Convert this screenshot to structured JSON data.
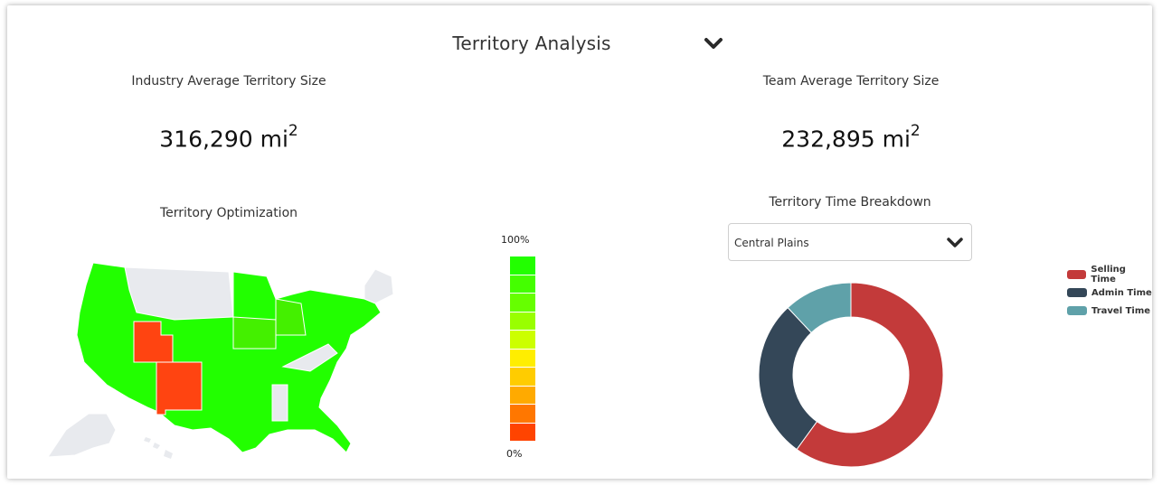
{
  "header": {
    "title": "Territory Analysis",
    "collapse_icon": "chevron-down-icon"
  },
  "industry": {
    "label": "Industry Average Territory Size",
    "value": "316,290 mi",
    "unit_exponent": "2"
  },
  "team": {
    "label": "Team Average Territory Size",
    "value": "232,895 mi",
    "unit_exponent": "2"
  },
  "optimization": {
    "title": "Territory Optimization",
    "scale_max_label": "100%",
    "scale_min_label": "0%",
    "scale_colors": [
      "#22ff00",
      "#44ff00",
      "#66ff00",
      "#99ff00",
      "#ccff00",
      "#ffee00",
      "#ffcc00",
      "#ffaa00",
      "#ff7700",
      "#ff4400"
    ],
    "map_colors": {
      "good": "#22ff00",
      "good_alt": "#44f000",
      "bad": "#ff4411",
      "none": "#e8eaee"
    }
  },
  "time_breakdown": {
    "title": "Territory Time Breakdown",
    "select": {
      "selected": "Central Plains",
      "icon": "chevron-down-icon"
    }
  },
  "chart_data": {
    "type": "pie",
    "title": "Territory Time Breakdown",
    "series": [
      {
        "name": "Selling Time",
        "value": 60,
        "color": "#c33a3a"
      },
      {
        "name": "Admin Time",
        "value": 28,
        "color": "#344758"
      },
      {
        "name": "Travel Time",
        "value": 12,
        "color": "#5fa1a9"
      }
    ],
    "legend_position": "right"
  }
}
